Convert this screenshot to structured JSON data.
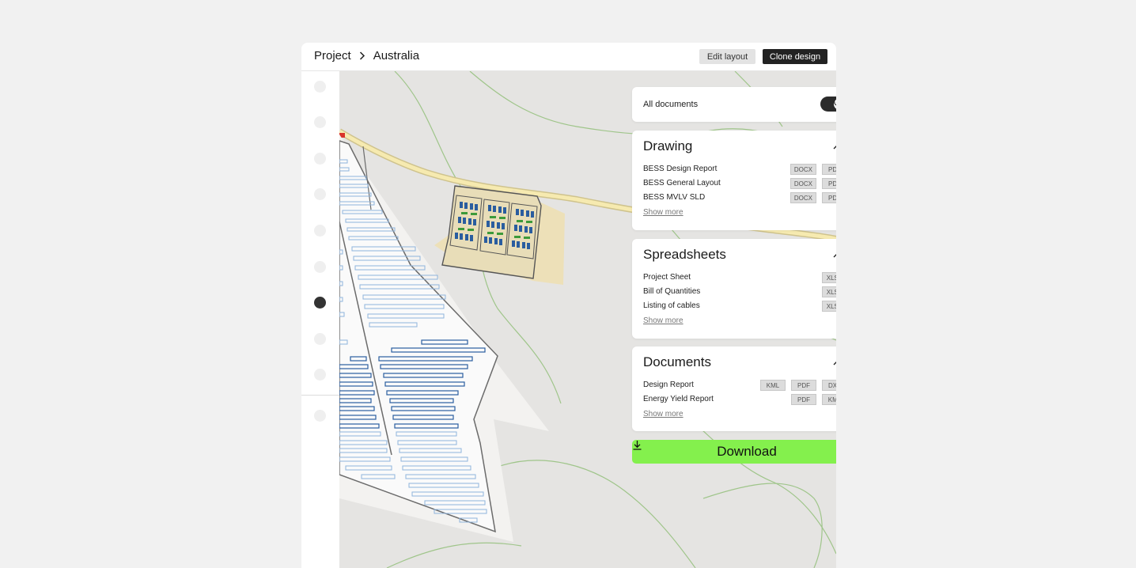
{
  "breadcrumb": {
    "root": "Project",
    "current": "Australia"
  },
  "header": {
    "edit_label": "Edit layout",
    "clone_label": "Clone design"
  },
  "sidebar": {
    "active_index": 6
  },
  "panel": {
    "all_documents": {
      "label": "All documents",
      "enabled": true
    },
    "sections": [
      {
        "title": "Drawing",
        "expanded": true,
        "items": [
          {
            "name": "BESS Design Report",
            "formats": [
              "DOCX",
              "PDF"
            ]
          },
          {
            "name": "BESS General Layout",
            "formats": [
              "DOCX",
              "PDF"
            ]
          },
          {
            "name": "BESS MVLV SLD",
            "formats": [
              "DOCX",
              "PDF"
            ]
          }
        ],
        "more": "Show more"
      },
      {
        "title": "Spreadsheets",
        "expanded": true,
        "items": [
          {
            "name": "Project Sheet",
            "formats": [
              "XLSX"
            ]
          },
          {
            "name": "Bill of Quantities",
            "formats": [
              "XLSX"
            ]
          },
          {
            "name": "Listing of cables",
            "formats": [
              "XLSX"
            ]
          }
        ],
        "more": "Show more"
      },
      {
        "title": "Documents",
        "expanded": true,
        "items": [
          {
            "name": "Design Report",
            "formats": [
              "KML",
              "PDF",
              "DXF"
            ]
          },
          {
            "name": "Energy Yield Report",
            "formats": [
              "PDF",
              "KML"
            ]
          }
        ],
        "more": "Show more"
      }
    ],
    "download_label": "Download"
  },
  "colors": {
    "accent": "#84f04d",
    "dark": "#222222",
    "map_bg": "#e5e4e2",
    "road": "#f4e8a8",
    "panel_blue": "#2a5d9f",
    "site_sand": "#ede0b8"
  },
  "icons": {
    "breadcrumb_sep": "chevron-right-icon",
    "toggle": "check-icon",
    "collapse": "chevron-up-icon",
    "download": "download-icon"
  }
}
